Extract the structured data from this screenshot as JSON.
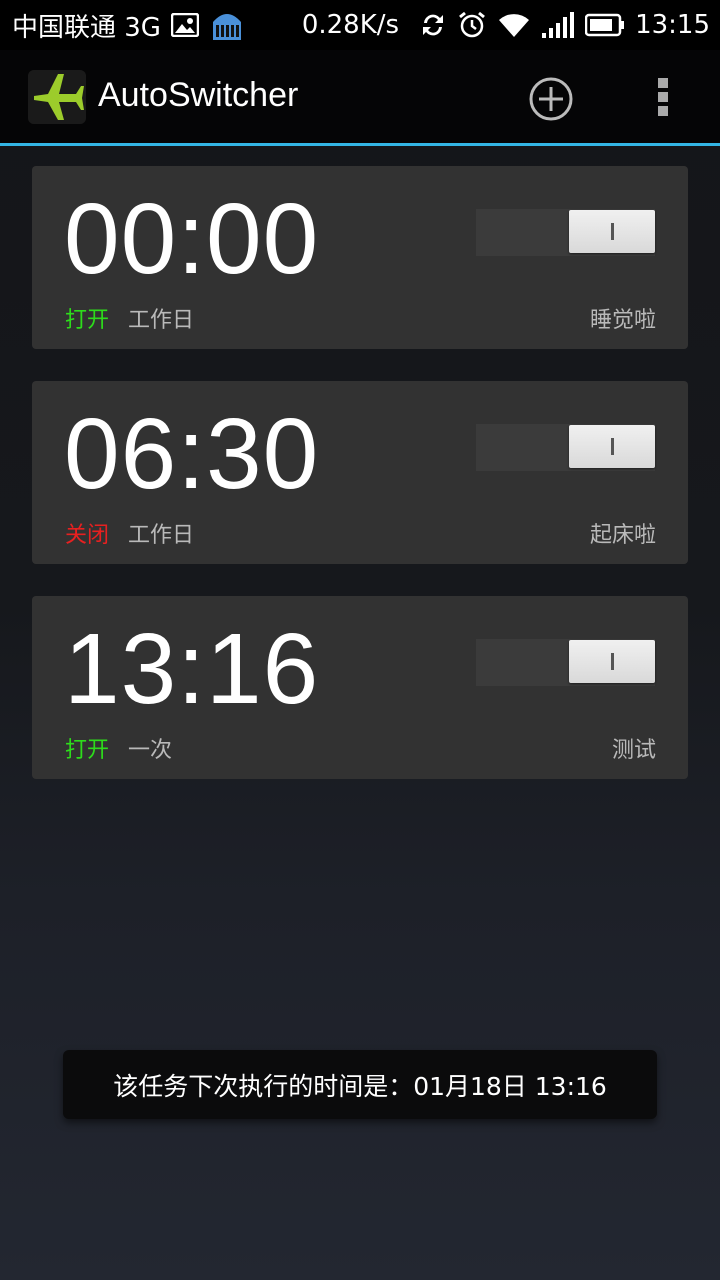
{
  "status_bar": {
    "carrier": "中国联通 3G",
    "speed": "0.28K/s",
    "time": "13:15",
    "icons": [
      "image-icon",
      "building-icon",
      "sync-icon",
      "alarm-icon",
      "wifi-icon",
      "signal-icon",
      "battery-icon"
    ]
  },
  "action_bar": {
    "title": "AutoSwitcher",
    "icon": "airplane-icon",
    "accent": "#33b5e5"
  },
  "tasks": [
    {
      "time": "00:00",
      "status": "打开",
      "status_color": "#2ddc1b",
      "repeat": "工作日",
      "label": "睡觉啦",
      "enabled": true
    },
    {
      "time": "06:30",
      "status": "关闭",
      "status_color": "#e82020",
      "repeat": "工作日",
      "label": "起床啦",
      "enabled": true
    },
    {
      "time": "13:16",
      "status": "打开",
      "status_color": "#2ddc1b",
      "repeat": "一次",
      "label": "测试",
      "enabled": true
    }
  ],
  "toast": {
    "message": "该任务下次执行的时间是：01月18日 13:16"
  }
}
